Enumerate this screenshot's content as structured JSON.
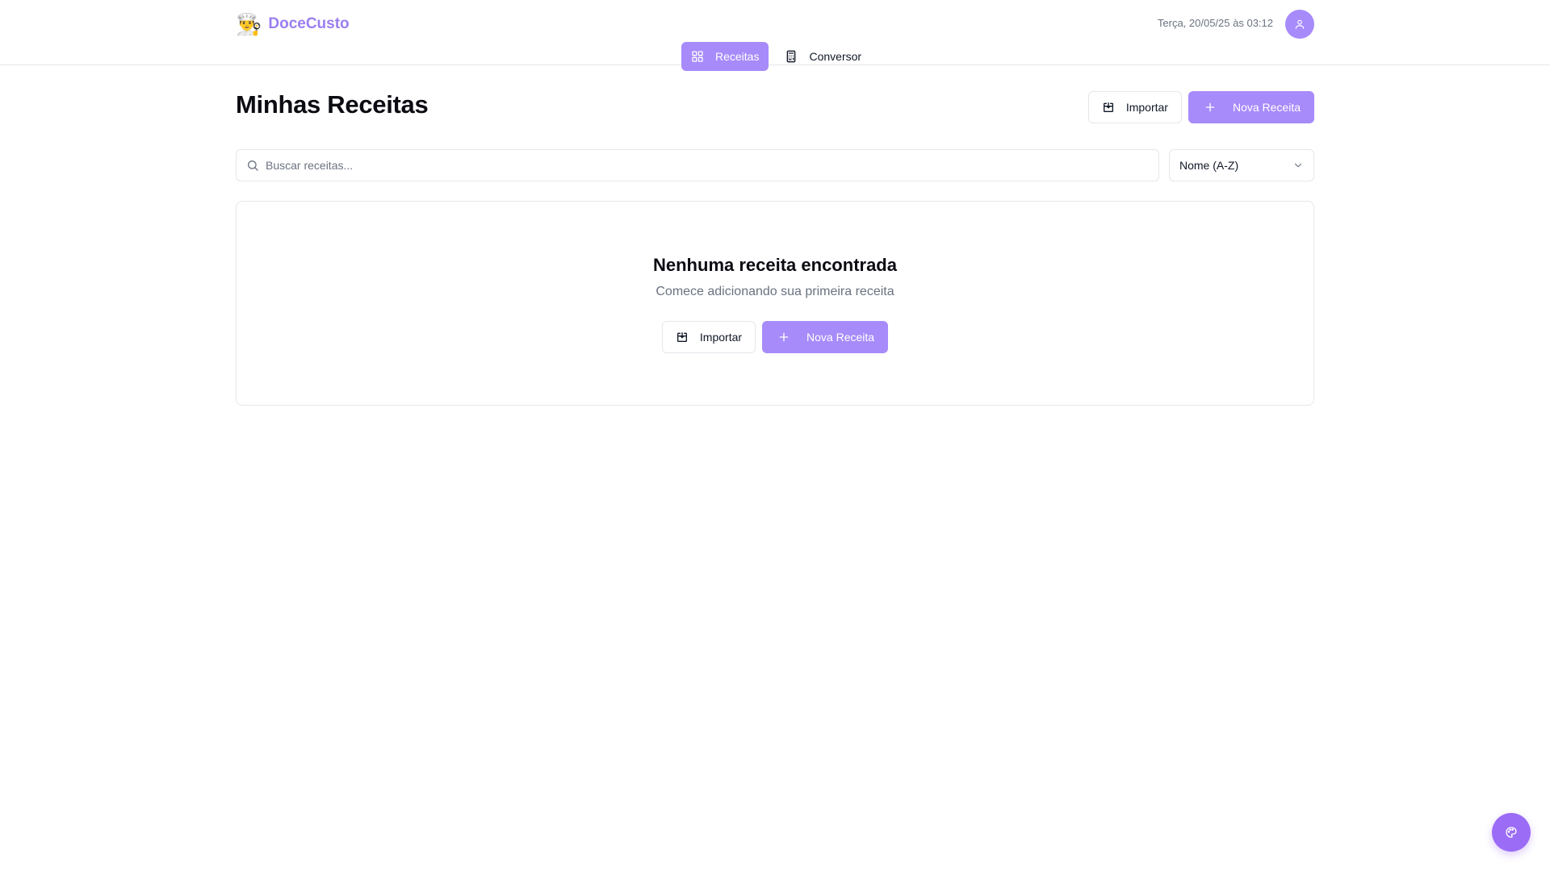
{
  "brand": {
    "emoji": "👨‍🍳",
    "name": "DoceCusto"
  },
  "header": {
    "datetime": "Terça, 20/05/25 às 03:12"
  },
  "nav": {
    "tabs": [
      {
        "label": "Receitas",
        "icon": "grid-icon",
        "active": true
      },
      {
        "label": "Conversor",
        "icon": "calculator-icon",
        "active": false
      }
    ]
  },
  "page": {
    "title": "Minhas Receitas",
    "import_label": "Importar",
    "new_label": "Nova Receita"
  },
  "search": {
    "placeholder": "Buscar receitas...",
    "value": ""
  },
  "sort": {
    "selected": "Nome (A-Z)"
  },
  "empty_state": {
    "title": "Nenhuma receita encontrada",
    "subtitle": "Comece adicionando sua primeira receita",
    "import_label": "Importar",
    "new_label": "Nova Receita"
  },
  "colors": {
    "accent": "#a78bfa",
    "fab": "#9b6cf5",
    "brand_text": "#9b7ef0"
  },
  "icons": {
    "avatar": "user-icon",
    "fab": "palette-icon",
    "import": "download-icon",
    "new": "plus-icon",
    "search": "search-icon",
    "sort": "chevron-down-icon"
  }
}
